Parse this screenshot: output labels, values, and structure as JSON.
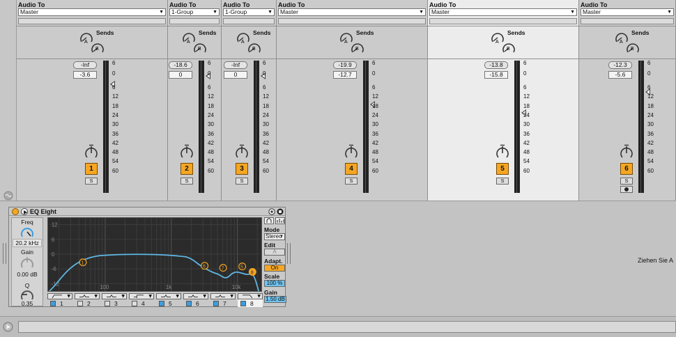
{
  "mixer": {
    "tracks": [
      {
        "io_label": "Audio To",
        "output": "Master",
        "sends_label": "Sends",
        "peak": "-Inf",
        "volume": "-3.6",
        "number": "1",
        "solo": "S"
      },
      {
        "io_label": "Audio To",
        "output": "1-Group",
        "sends_label": "Sends",
        "peak": "-18.6",
        "volume": "0",
        "number": "2",
        "solo": "S"
      },
      {
        "io_label": "Audio To",
        "output": "1-Group",
        "sends_label": "Sends",
        "peak": "-Inf",
        "volume": "0",
        "number": "3",
        "solo": "S"
      },
      {
        "io_label": "Audio To",
        "output": "Master",
        "sends_label": "Sends",
        "peak": "-19.9",
        "volume": "-12.7",
        "number": "4",
        "solo": "S"
      },
      {
        "io_label": "Audio To",
        "output": "Master",
        "sends_label": "Sends",
        "peak": "-13.8",
        "volume": "-15.8",
        "number": "5",
        "solo": "S"
      },
      {
        "io_label": "Audio To",
        "output": "Master",
        "sends_label": "Sends",
        "peak": "-12.3",
        "volume": "-5.6",
        "number": "6",
        "solo": "S"
      }
    ],
    "send_knob_labels": [
      "A",
      "B"
    ],
    "meter_scale": [
      "6",
      "0",
      "6",
      "12",
      "18",
      "24",
      "30",
      "36",
      "42",
      "48",
      "54",
      "60"
    ]
  },
  "device": {
    "title": "EQ Eight",
    "freq_label": "Freq",
    "freq_value": "20.2 kHz",
    "gain_label": "Gain",
    "gain_value": "0.00 dB",
    "q_label": "Q",
    "q_value": "0.35",
    "db_labels": [
      "12",
      "6",
      "0",
      "-6",
      "-12"
    ],
    "freq_labels": [
      "100",
      "1k",
      "10k"
    ],
    "bands": [
      "1",
      "2",
      "3",
      "4",
      "5",
      "6",
      "7",
      "8"
    ],
    "band_enabled": [
      true,
      false,
      false,
      false,
      true,
      true,
      true,
      true
    ],
    "selected_band": "8",
    "curve_color": "#5fb8e6",
    "node_color": "#f5a623",
    "mode_label": "Mode",
    "mode_value": "Stereo",
    "edit_label": "Edit",
    "edit_value": "A",
    "adaptq_label": "Adapt. Q",
    "adaptq_value": "On",
    "scale_label": "Scale",
    "scale_value": "100 %",
    "gain_out_label": "Gain",
    "gain_out_value": "1.50 dB"
  },
  "drop_hint": "Ziehen Sie A"
}
